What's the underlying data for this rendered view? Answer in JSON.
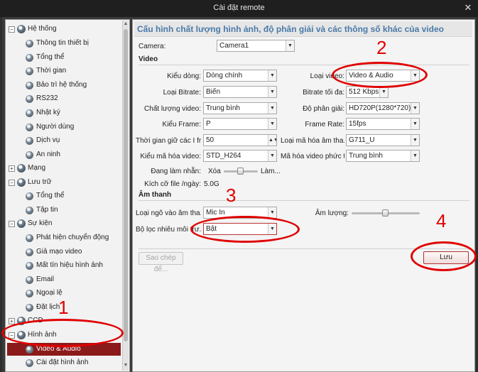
{
  "window": {
    "title": "Cài đặt remote"
  },
  "sidebar": {
    "groups": [
      {
        "label": "Hệ thống",
        "expanded": true,
        "items": [
          "Thông tin thiết bị",
          "Tổng thể",
          "Thời gian",
          "Bảo trì hệ thống",
          "RS232",
          "Nhật ký",
          "Người dùng",
          "Dịch vụ",
          "An ninh"
        ]
      },
      {
        "label": "Mạng",
        "expanded": false,
        "items": []
      },
      {
        "label": "Lưu trữ",
        "expanded": true,
        "items": [
          "Tổng thể",
          "Tập tin"
        ]
      },
      {
        "label": "Sự kiện",
        "expanded": true,
        "items": [
          "Phát hiện chuyển động",
          "Giả mạo video",
          "Mất tín hiệu hình ảnh",
          "Email",
          "Ngoại lệ",
          "Đặt lịch"
        ]
      },
      {
        "label": "CCD",
        "expanded": false,
        "items": []
      },
      {
        "label": "Hình ảnh",
        "expanded": true,
        "items": [
          "Video & Audio",
          "Cài đặt hình ảnh"
        ]
      }
    ],
    "selected_item": "Video & Audio"
  },
  "header": {
    "title": "Cấu hình chất lượng hình ảnh, độ phân giải và các thông số khác của video"
  },
  "camera": {
    "label": "Camera:",
    "value": "Camera1"
  },
  "video": {
    "section_title": "Video",
    "fields": {
      "stream_type": {
        "label": "Kiểu dòng:",
        "value": "Dòng chính"
      },
      "video_type": {
        "label": "Loại video:",
        "value": "Video & Audio"
      },
      "bitrate_type": {
        "label": "Loại Bitrate:",
        "value": "Biến"
      },
      "max_bitrate": {
        "label": "Bitrate tối đa:",
        "value": "512 Kbps"
      },
      "video_quality": {
        "label": "Chất lượng video:",
        "value": "Trung bình"
      },
      "resolution": {
        "label": "Độ phân giải:",
        "value": "HD720P(1280*720)"
      },
      "frame_type": {
        "label": "Kiểu Frame:",
        "value": "P"
      },
      "frame_rate": {
        "label": "Frame Rate:",
        "value": "15fps"
      },
      "i_frame_interval": {
        "label": "Thời gian giữ các I fr...",
        "value": "50"
      },
      "audio_encoding": {
        "label": "Loại mã hóa âm tha...",
        "value": "G711_U"
      },
      "video_encoding": {
        "label": "Kiểu mã hóa video:",
        "value": "STD_H264"
      },
      "encoding_complexity": {
        "label": "Mã hóa video phức t...",
        "value": "Trung bình"
      },
      "smoothing": {
        "label": "Đang làm nhẵn:",
        "min_label": "Xóa",
        "max_label": "Làm...",
        "level": 0.5
      },
      "file_size": {
        "label": "Kích cỡ file /ngày:",
        "value": "5.0G"
      }
    }
  },
  "audio": {
    "section_title": "Âm thanh",
    "fields": {
      "audio_input": {
        "label": "Loại ngõ vào âm tha...",
        "value": "Mic In"
      },
      "volume": {
        "label": "Âm lượng:",
        "level": 0.5
      },
      "noise_filter": {
        "label": "Bộ lọc nhiễu môi trư...",
        "value": "Bật"
      }
    }
  },
  "buttons": {
    "copy": "Sao chép để...",
    "save": "Lưu"
  },
  "annotations": {
    "one": "1",
    "two": "2",
    "three": "3",
    "four": "4",
    "color": "#e00000"
  }
}
